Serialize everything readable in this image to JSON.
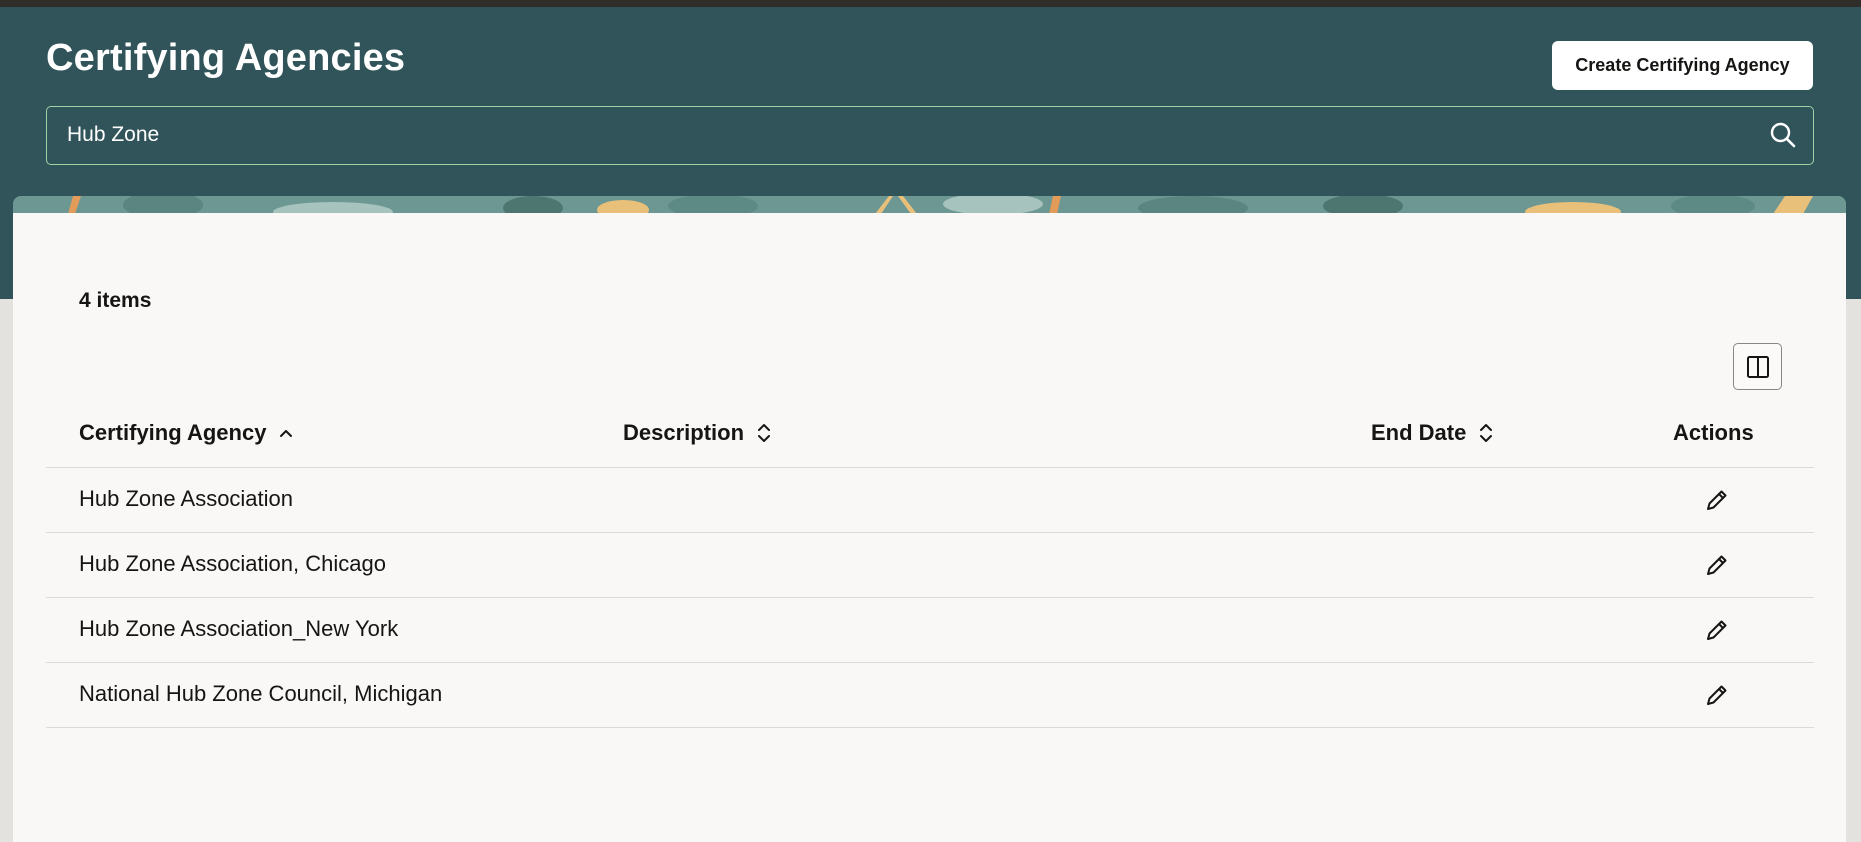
{
  "header": {
    "title": "Certifying Agencies",
    "create_button": "Create Certifying Agency",
    "search_value": "Hub Zone"
  },
  "results": {
    "count_label": "4 items"
  },
  "table": {
    "columns": [
      {
        "label": "Certifying Agency",
        "sort": "ascending"
      },
      {
        "label": "Description",
        "sort": "none"
      },
      {
        "label": "End Date",
        "sort": "none"
      },
      {
        "label": "Actions",
        "sort": "none"
      }
    ],
    "rows": [
      {
        "agency": "Hub Zone Association",
        "description": "",
        "end_date": ""
      },
      {
        "agency": "Hub Zone Association, Chicago",
        "description": "",
        "end_date": ""
      },
      {
        "agency": "Hub Zone Association_New York",
        "description": "",
        "end_date": ""
      },
      {
        "agency": "National Hub Zone Council, Michigan",
        "description": "",
        "end_date": ""
      }
    ]
  },
  "icons": {
    "search": "search-icon",
    "column_manager": "columns-icon",
    "edit": "pencil-icon",
    "sort_asc": "chevron-up-icon",
    "sort_unsorted": "sort-updown-icon"
  },
  "colors": {
    "header_bg": "#30545a",
    "search_border": "#9fd3a5",
    "card_bg": "#f9f8f6",
    "top_bar": "#312d2a"
  }
}
